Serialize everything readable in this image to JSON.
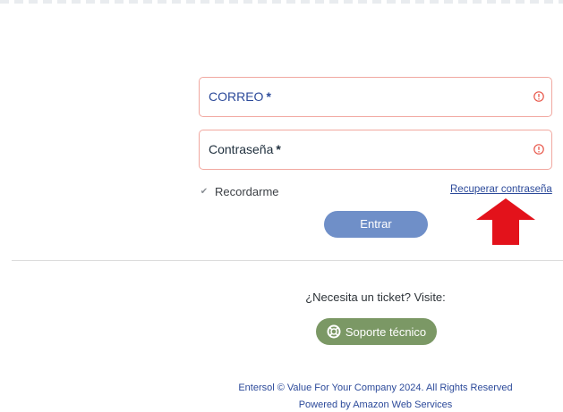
{
  "login_form": {
    "email_label": "CORREO",
    "password_label": "Contraseña",
    "required_marker": "*",
    "remember_label": "Recordarme",
    "remember_checked": true,
    "recover_link": "Recuperar contraseña",
    "submit_label": "Entrar"
  },
  "support": {
    "prompt": "¿Necesita un ticket? Visite:",
    "button_label": "Soporte técnico"
  },
  "footer": {
    "copyright": "Entersol © Value For Your Company 2024. All Rights Reserved",
    "powered_by": "Powered by Amazon Web Services"
  },
  "icons": {
    "error": "exclamation-circle-icon",
    "annotation": "red-up-arrow",
    "support": "life-ring-icon"
  },
  "colors": {
    "error_border": "#f1a8a0",
    "error_icon": "#e8574a",
    "primary_button": "#6f8fc8",
    "support_button": "#7b9865",
    "link": "#2c4a9a",
    "arrow": "#e3121b"
  }
}
